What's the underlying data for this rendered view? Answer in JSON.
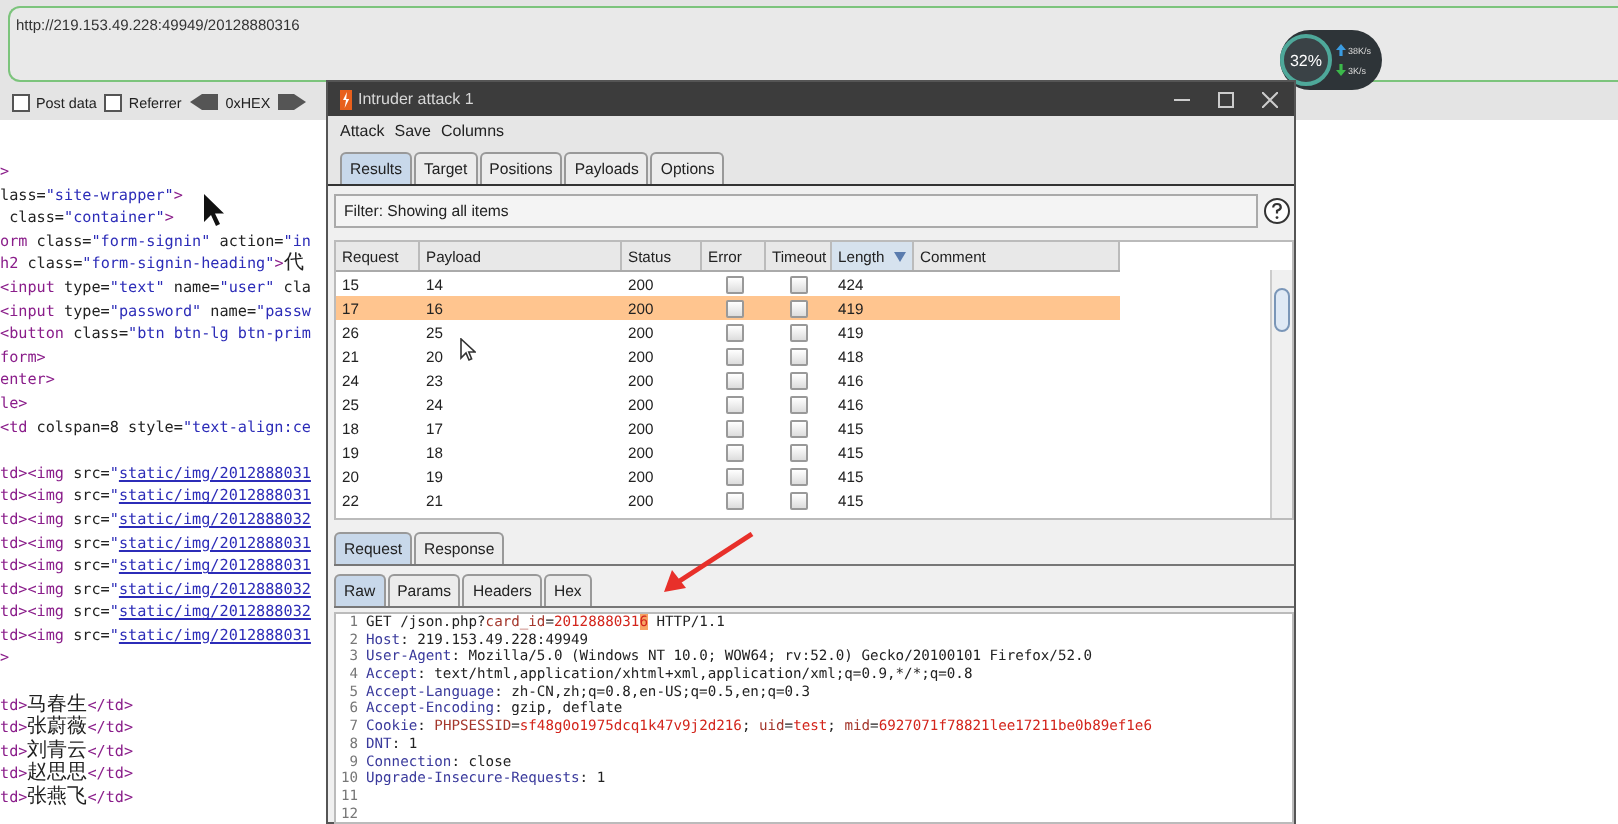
{
  "browser": {
    "url": "http://219.153.49.228:49949/20128880316",
    "options": [
      {
        "label": "Post data",
        "checked": false
      },
      {
        "label": "Referrer",
        "checked": false
      }
    ],
    "encode_label": "0xHEX"
  },
  "source_lines": [
    {
      "parts": [
        {
          "text": ">",
          "kind": "tag"
        }
      ]
    },
    {
      "parts": [
        {
          "text": "lass=",
          "kind": "attr"
        },
        {
          "text": "\"site-wrapper\"",
          "kind": "value"
        },
        {
          "text": ">",
          "kind": "tag"
        }
      ]
    },
    {
      "parts": [
        {
          "text": " class=",
          "kind": "attr"
        },
        {
          "text": "\"container\"",
          "kind": "value"
        },
        {
          "text": ">",
          "kind": "tag"
        }
      ]
    },
    {
      "parts": [
        {
          "text": "orm",
          "kind": "tag"
        },
        {
          "text": " class=",
          "kind": "attr"
        },
        {
          "text": "\"form-signin\"",
          "kind": "value"
        },
        {
          "text": " action=",
          "kind": "attr"
        },
        {
          "text": "\"in",
          "kind": "value"
        }
      ]
    },
    {
      "parts": [
        {
          "text": "h2",
          "kind": "tag"
        },
        {
          "text": " class=",
          "kind": "attr"
        },
        {
          "text": "\"form-signin-heading\"",
          "kind": "value"
        },
        {
          "text": ">",
          "kind": "tag"
        },
        {
          "text": "代",
          "kind": "cjk"
        }
      ]
    },
    {
      "parts": [
        {
          "text": "<input",
          "kind": "tag"
        },
        {
          "text": " type=",
          "kind": "attr"
        },
        {
          "text": "\"text\"",
          "kind": "value"
        },
        {
          "text": " name=",
          "kind": "attr"
        },
        {
          "text": "\"user\"",
          "kind": "value"
        },
        {
          "text": " cla",
          "kind": "attr"
        }
      ]
    },
    {
      "parts": [
        {
          "text": "<input",
          "kind": "tag"
        },
        {
          "text": " type=",
          "kind": "attr"
        },
        {
          "text": "\"password\"",
          "kind": "value"
        },
        {
          "text": " name=",
          "kind": "attr"
        },
        {
          "text": "\"passw",
          "kind": "value"
        }
      ]
    },
    {
      "parts": [
        {
          "text": "<button",
          "kind": "tag"
        },
        {
          "text": " class=",
          "kind": "attr"
        },
        {
          "text": "\"btn btn-lg btn-prim",
          "kind": "value"
        }
      ]
    },
    {
      "parts": [
        {
          "text": "form>",
          "kind": "tag"
        }
      ]
    },
    {
      "parts": [
        {
          "text": "enter>",
          "kind": "tag"
        }
      ]
    },
    {
      "parts": [
        {
          "text": "le>",
          "kind": "tag"
        }
      ]
    },
    {
      "parts": [
        {
          "text": "<td",
          "kind": "tag"
        },
        {
          "text": " colspan=",
          "kind": "attr"
        },
        {
          "text": "8",
          "kind": "plain"
        },
        {
          "text": " style=",
          "kind": "attr"
        },
        {
          "text": "\"text-align:ce",
          "kind": "value"
        }
      ]
    },
    {
      "gap_before": true,
      "parts": [
        {
          "text": "td><img",
          "kind": "tag"
        },
        {
          "text": " src=",
          "kind": "attr"
        },
        {
          "text": "\"",
          "kind": "value"
        },
        {
          "text": "static/img/2012888031",
          "kind": "link"
        }
      ]
    },
    {
      "parts": [
        {
          "text": "td><img",
          "kind": "tag"
        },
        {
          "text": " src=",
          "kind": "attr"
        },
        {
          "text": "\"",
          "kind": "value"
        },
        {
          "text": "static/img/2012888031",
          "kind": "link"
        }
      ]
    },
    {
      "parts": [
        {
          "text": "td><img",
          "kind": "tag"
        },
        {
          "text": " src=",
          "kind": "attr"
        },
        {
          "text": "\"",
          "kind": "value"
        },
        {
          "text": "static/img/2012888032",
          "kind": "link"
        }
      ]
    },
    {
      "parts": [
        {
          "text": "td><img",
          "kind": "tag"
        },
        {
          "text": " src=",
          "kind": "attr"
        },
        {
          "text": "\"",
          "kind": "value"
        },
        {
          "text": "static/img/2012888031",
          "kind": "link"
        }
      ]
    },
    {
      "parts": [
        {
          "text": "td><img",
          "kind": "tag"
        },
        {
          "text": " src=",
          "kind": "attr"
        },
        {
          "text": "\"",
          "kind": "value"
        },
        {
          "text": "static/img/2012888031",
          "kind": "link"
        }
      ]
    },
    {
      "parts": [
        {
          "text": "td><img",
          "kind": "tag"
        },
        {
          "text": " src=",
          "kind": "attr"
        },
        {
          "text": "\"",
          "kind": "value"
        },
        {
          "text": "static/img/2012888032",
          "kind": "link"
        }
      ]
    },
    {
      "parts": [
        {
          "text": "td><img",
          "kind": "tag"
        },
        {
          "text": " src=",
          "kind": "attr"
        },
        {
          "text": "\"",
          "kind": "value"
        },
        {
          "text": "static/img/2012888032",
          "kind": "link"
        }
      ]
    },
    {
      "parts": [
        {
          "text": "td><img",
          "kind": "tag"
        },
        {
          "text": " src=",
          "kind": "attr"
        },
        {
          "text": "\"",
          "kind": "value"
        },
        {
          "text": "static/img/2012888031",
          "kind": "link"
        }
      ]
    },
    {
      "parts": [
        {
          "text": ">",
          "kind": "tag"
        }
      ]
    },
    {
      "gap_before": true,
      "parts": [
        {
          "text": "td>",
          "kind": "tag"
        },
        {
          "text": "马春生",
          "kind": "cjk"
        },
        {
          "text": "</td>",
          "kind": "tag"
        }
      ]
    },
    {
      "parts": [
        {
          "text": "td>",
          "kind": "tag"
        },
        {
          "text": "张蔚薇",
          "kind": "cjk"
        },
        {
          "text": "</td>",
          "kind": "tag"
        }
      ]
    },
    {
      "parts": [
        {
          "text": "td>",
          "kind": "tag"
        },
        {
          "text": "刘青云",
          "kind": "cjk"
        },
        {
          "text": "</td>",
          "kind": "tag"
        }
      ]
    },
    {
      "parts": [
        {
          "text": "td>",
          "kind": "tag"
        },
        {
          "text": "赵思思",
          "kind": "cjk"
        },
        {
          "text": "</td>",
          "kind": "tag"
        }
      ]
    },
    {
      "parts": [
        {
          "text": "td>",
          "kind": "tag"
        },
        {
          "text": "张燕飞",
          "kind": "cjk"
        },
        {
          "text": "</td>",
          "kind": "tag"
        }
      ]
    }
  ],
  "network_widget": {
    "load": "32%",
    "upload": "38K/s",
    "download": "3K/s"
  },
  "window": {
    "title": "Intruder attack 1",
    "menu": [
      "Attack",
      "Save",
      "Columns"
    ],
    "tabs": [
      {
        "label": "Results",
        "selected": true
      },
      {
        "label": "Target",
        "selected": false
      },
      {
        "label": "Positions",
        "selected": false
      },
      {
        "label": "Payloads",
        "selected": false
      },
      {
        "label": "Options",
        "selected": false
      }
    ],
    "filter": "Filter: Showing all items",
    "table": {
      "columns": [
        {
          "label": "Request",
          "sorted": false
        },
        {
          "label": "Payload",
          "sorted": false
        },
        {
          "label": "Status",
          "sorted": false
        },
        {
          "label": "Error",
          "sorted": false
        },
        {
          "label": "Timeout",
          "sorted": false
        },
        {
          "label": "Length",
          "sorted": true
        },
        {
          "label": "Comment",
          "sorted": false
        }
      ],
      "rows": [
        {
          "request": "15",
          "payload": "14",
          "status": "200",
          "error": false,
          "timeout": false,
          "length": "424",
          "selected": false
        },
        {
          "request": "17",
          "payload": "16",
          "status": "200",
          "error": false,
          "timeout": false,
          "length": "419",
          "selected": true
        },
        {
          "request": "26",
          "payload": "25",
          "status": "200",
          "error": false,
          "timeout": false,
          "length": "419",
          "selected": false
        },
        {
          "request": "21",
          "payload": "20",
          "status": "200",
          "error": false,
          "timeout": false,
          "length": "418",
          "selected": false
        },
        {
          "request": "24",
          "payload": "23",
          "status": "200",
          "error": false,
          "timeout": false,
          "length": "416",
          "selected": false
        },
        {
          "request": "25",
          "payload": "24",
          "status": "200",
          "error": false,
          "timeout": false,
          "length": "416",
          "selected": false
        },
        {
          "request": "18",
          "payload": "17",
          "status": "200",
          "error": false,
          "timeout": false,
          "length": "415",
          "selected": false
        },
        {
          "request": "19",
          "payload": "18",
          "status": "200",
          "error": false,
          "timeout": false,
          "length": "415",
          "selected": false
        },
        {
          "request": "20",
          "payload": "19",
          "status": "200",
          "error": false,
          "timeout": false,
          "length": "415",
          "selected": false
        },
        {
          "request": "22",
          "payload": "21",
          "status": "200",
          "error": false,
          "timeout": false,
          "length": "415",
          "selected": false
        }
      ]
    },
    "detail_tabs": [
      {
        "label": "Request",
        "selected": true
      },
      {
        "label": "Response",
        "selected": false
      }
    ],
    "view_tabs": [
      {
        "label": "Raw",
        "selected": true
      },
      {
        "label": "Params",
        "selected": false
      },
      {
        "label": "Headers",
        "selected": false
      },
      {
        "label": "Hex",
        "selected": false
      }
    ],
    "raw_lines": [
      {
        "number": "1",
        "parts": [
          {
            "text": "GET /json.php?",
            "kind": "plain"
          },
          {
            "text": "card_id",
            "kind": "param"
          },
          {
            "text": "=",
            "kind": "plain"
          },
          {
            "text": "2012888031",
            "kind": "value"
          },
          {
            "text": "6",
            "kind": "mark"
          },
          {
            "text": " HTTP/1.1",
            "kind": "plain"
          }
        ]
      },
      {
        "number": "2",
        "parts": [
          {
            "text": "Host",
            "kind": "name"
          },
          {
            "text": ": 219.153.49.228:49949",
            "kind": "plain"
          }
        ]
      },
      {
        "number": "3",
        "parts": [
          {
            "text": "User-Agent",
            "kind": "name"
          },
          {
            "text": ": Mozilla/5.0 (Windows NT 10.0; WOW64; rv:52.0) Gecko/20100101 Firefox/52.0",
            "kind": "plain"
          }
        ]
      },
      {
        "number": "4",
        "parts": [
          {
            "text": "Accept",
            "kind": "name"
          },
          {
            "text": ": text/html,application/xhtml+xml,application/xml;q=0.9,*/*;q=0.8",
            "kind": "plain"
          }
        ]
      },
      {
        "number": "5",
        "parts": [
          {
            "text": "Accept-Language",
            "kind": "name"
          },
          {
            "text": ": zh-CN,zh;q=0.8,en-US;q=0.5,en;q=0.3",
            "kind": "plain"
          }
        ]
      },
      {
        "number": "6",
        "parts": [
          {
            "text": "Accept-Encoding",
            "kind": "name"
          },
          {
            "text": ": gzip, deflate",
            "kind": "plain"
          }
        ]
      },
      {
        "number": "7",
        "parts": [
          {
            "text": "Cookie",
            "kind": "name"
          },
          {
            "text": ": ",
            "kind": "plain"
          },
          {
            "text": "PHPSESSID",
            "kind": "param"
          },
          {
            "text": "=",
            "kind": "plain"
          },
          {
            "text": "sf48g0o1975dcq1k47v9j2d216",
            "kind": "value"
          },
          {
            "text": "; ",
            "kind": "plain"
          },
          {
            "text": "uid",
            "kind": "param"
          },
          {
            "text": "=",
            "kind": "plain"
          },
          {
            "text": "test",
            "kind": "value"
          },
          {
            "text": "; ",
            "kind": "plain"
          },
          {
            "text": "mid",
            "kind": "param"
          },
          {
            "text": "=",
            "kind": "plain"
          },
          {
            "text": "6927071f78821lee17211be0b89ef1e6",
            "kind": "value"
          }
        ]
      },
      {
        "number": "8",
        "parts": [
          {
            "text": "DNT",
            "kind": "name"
          },
          {
            "text": ": 1",
            "kind": "plain"
          }
        ]
      },
      {
        "number": "9",
        "parts": [
          {
            "text": "Connection",
            "kind": "name"
          },
          {
            "text": ": close",
            "kind": "plain"
          }
        ]
      },
      {
        "number": "10",
        "parts": [
          {
            "text": "Upgrade-Insecure-Requests",
            "kind": "name"
          },
          {
            "text": ": 1",
            "kind": "plain"
          }
        ]
      },
      {
        "number": "11"
      },
      {
        "number": "12"
      }
    ]
  }
}
